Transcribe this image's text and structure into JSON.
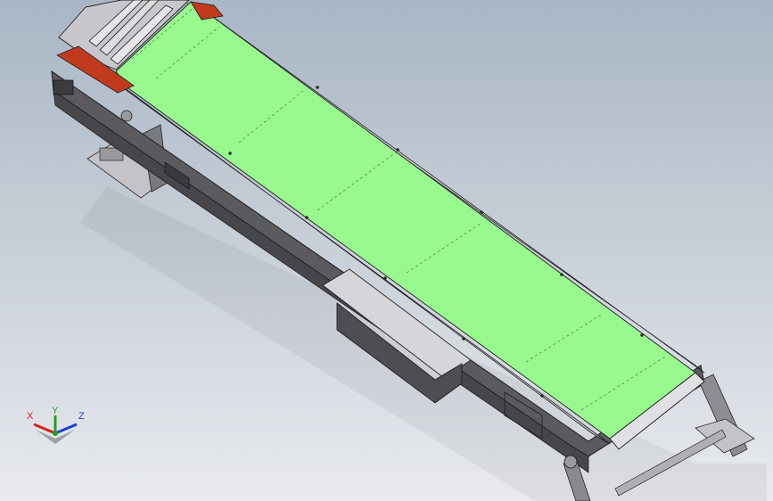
{
  "app": {
    "type": "cad-3d-viewport"
  },
  "model": {
    "description_visible": false,
    "colors": {
      "belt": "#98f98e",
      "frame": "#5f5f63",
      "frame_dark": "#3d3d41",
      "rail": "#c9c9cd",
      "accent_red": "#c23a1e",
      "panel_light": "#d8d8dc",
      "support": "#8a8a8e",
      "edge": "#1e1e1e"
    }
  },
  "triad": {
    "x_label": "X",
    "y_label": "Y",
    "z_label": "Z",
    "x_color": "#d42020",
    "y_color": "#1ea01e",
    "z_color": "#1f3fd6"
  }
}
